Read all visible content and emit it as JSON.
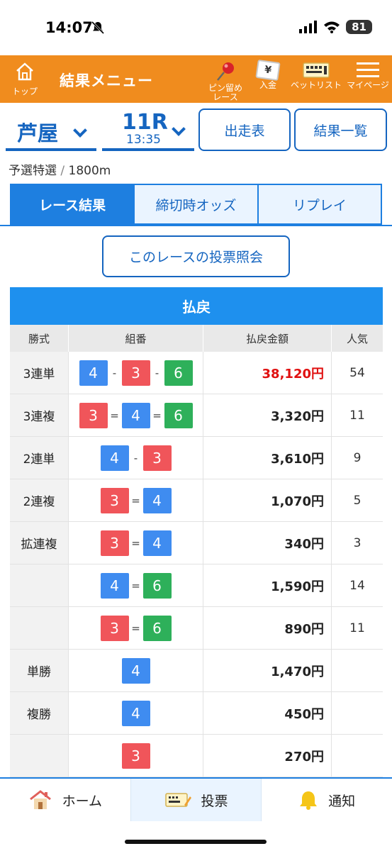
{
  "status_bar": {
    "time": "14:07",
    "battery": "81"
  },
  "header": {
    "top_label": "トップ",
    "title": "結果メニュー",
    "pin_label_1": "ピン留め",
    "pin_label_2": "レース",
    "deposit_label": "入金",
    "deposit_symbol": "¥",
    "betlist_label": "ベットリスト",
    "mypage_label": "マイページ",
    "colors": {
      "brand": "#f08c1e",
      "accent": "#1e7fe0"
    }
  },
  "selector": {
    "venue": "芦屋",
    "race": "11R",
    "race_time": "13:35",
    "entry_button": "出走表",
    "results_list_button": "結果一覧"
  },
  "race_info": {
    "type": "予選特選",
    "separator": "/",
    "distance": "1800m"
  },
  "tabs": [
    {
      "label": "レース結果",
      "active": true
    },
    {
      "label": "締切時オッズ",
      "active": false
    },
    {
      "label": "リプレイ",
      "active": false
    }
  ],
  "inquiry_button": "このレースの投票照会",
  "payout": {
    "title": "払戻",
    "headers": {
      "type": "勝式",
      "combo": "組番",
      "amount": "払戻金額",
      "popularity": "人気"
    },
    "rows": [
      {
        "type": "3連単",
        "combo": [
          4,
          3,
          6
        ],
        "sep": "-",
        "amount": "38,120円",
        "popularity": "54",
        "highlight": true
      },
      {
        "type": "3連複",
        "combo": [
          3,
          4,
          6
        ],
        "sep": "=",
        "amount": "3,320円",
        "popularity": "11"
      },
      {
        "type": "2連単",
        "combo": [
          4,
          3
        ],
        "sep": "-",
        "amount": "3,610円",
        "popularity": "9"
      },
      {
        "type": "2連複",
        "combo": [
          3,
          4
        ],
        "sep": "=",
        "amount": "1,070円",
        "popularity": "5"
      },
      {
        "type": "拡連複",
        "combo": [
          3,
          4
        ],
        "sep": "=",
        "amount": "340円",
        "popularity": "3"
      },
      {
        "type": "",
        "combo": [
          4,
          6
        ],
        "sep": "=",
        "amount": "1,590円",
        "popularity": "14"
      },
      {
        "type": "",
        "combo": [
          3,
          6
        ],
        "sep": "=",
        "amount": "890円",
        "popularity": "11"
      },
      {
        "type": "単勝",
        "combo": [
          4
        ],
        "sep": "",
        "amount": "1,470円",
        "popularity": ""
      },
      {
        "type": "複勝",
        "combo": [
          4
        ],
        "sep": "",
        "amount": "450円",
        "popularity": ""
      },
      {
        "type": "",
        "combo": [
          3
        ],
        "sep": "",
        "amount": "270円",
        "popularity": ""
      }
    ],
    "boat_colors": {
      "3": "#f0555a",
      "4": "#3f8cf0",
      "6": "#2eb05a"
    }
  },
  "bottom_nav": [
    {
      "label": "ホーム",
      "icon": "home-icon"
    },
    {
      "label": "投票",
      "icon": "ticket-icon",
      "active": true
    },
    {
      "label": "通知",
      "icon": "bell-icon"
    }
  ]
}
